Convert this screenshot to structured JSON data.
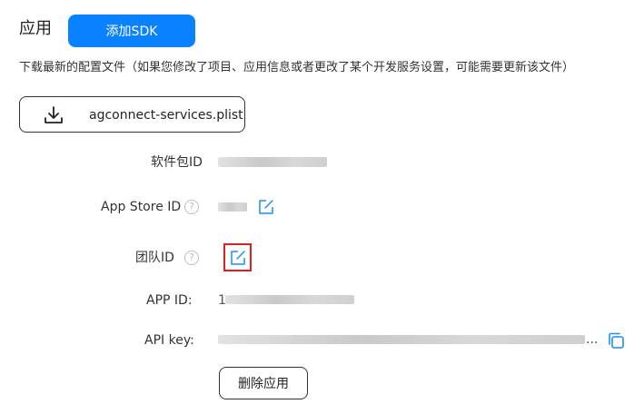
{
  "header": {
    "title": "应用",
    "add_sdk_label": "添加SDK"
  },
  "description": "下载最新的配置文件（如果您修改了项目、应用信息或者更改了某个开发服务设置，可能需要更新该文件）",
  "download": {
    "filename": "agconnect-services.plist",
    "icon": "download-icon"
  },
  "fields": {
    "bundle_id_label": "软件包ID",
    "app_store_id_label": "App Store ID",
    "team_id_label": "团队ID",
    "app_id_label": "APP ID:",
    "app_id_prefix": "1",
    "api_key_label": "API key:",
    "api_key_ellipsis": "...",
    "help_glyph": "?"
  },
  "actions": {
    "delete_app_label": "删除应用"
  },
  "colors": {
    "primary": "#0a82ff",
    "highlight": "#e02020",
    "icon_blue": "#1f8ef1"
  }
}
